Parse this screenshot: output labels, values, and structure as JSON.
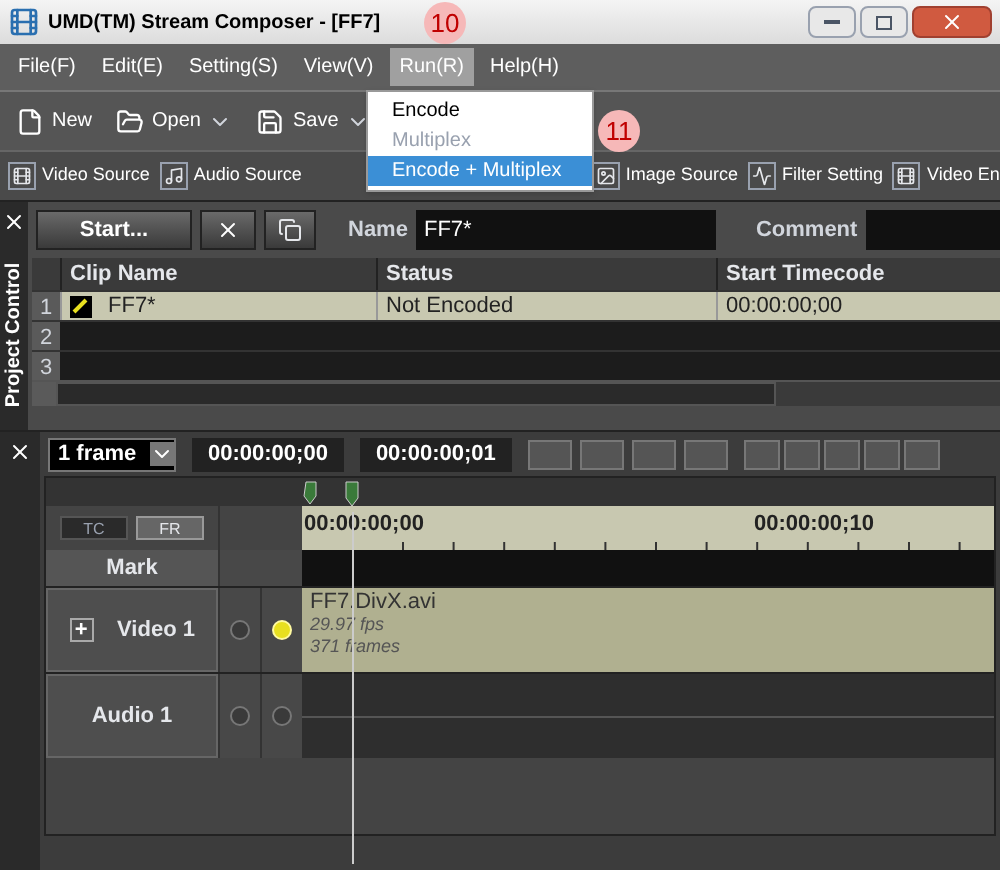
{
  "window": {
    "title": "UMD(TM) Stream Composer - [FF7]"
  },
  "menu": [
    {
      "label": "File(F)",
      "selected": false
    },
    {
      "label": "Edit(E)",
      "selected": false
    },
    {
      "label": "Setting(S)",
      "selected": false
    },
    {
      "label": "View(V)",
      "selected": false
    },
    {
      "label": "Run(R)",
      "selected": true
    },
    {
      "label": "Help(H)",
      "selected": false
    }
  ],
  "run_menu": [
    {
      "label": "Encode",
      "disabled": false,
      "selected": false
    },
    {
      "label": "Multiplex",
      "disabled": true,
      "selected": false
    },
    {
      "label": "Encode + Multiplex",
      "disabled": false,
      "selected": true
    }
  ],
  "annotations": [
    {
      "label": "10"
    },
    {
      "label": "11"
    }
  ],
  "toolbar": [
    {
      "label": "New",
      "kind": "button"
    },
    {
      "label": "Open",
      "kind": "dropdown"
    },
    {
      "label": "Save",
      "kind": "dropdown"
    }
  ],
  "source_toolbar": [
    {
      "label": "Video Source",
      "kind": "video"
    },
    {
      "label": "Audio Source",
      "kind": "audio"
    },
    {
      "label": "Image Source",
      "kind": "image"
    },
    {
      "label": "Filter Setting",
      "kind": "filter"
    },
    {
      "label": "Video En",
      "kind": "video"
    }
  ],
  "project_panel": {
    "title": "Project Control",
    "start_button": "Start...",
    "name_label": "Name",
    "name_value": "FF7*",
    "comment_label": "Comment"
  },
  "clips": {
    "columns": [
      "Clip Name",
      "Status",
      "Start Timecode"
    ],
    "rows": [
      {
        "number": "1",
        "selected": true,
        "checked": true,
        "cells": [
          "FF7*",
          "Not Encoded",
          "00:00:00;00"
        ]
      },
      {
        "number": "2",
        "selected": false
      },
      {
        "number": "3",
        "selected": false
      }
    ]
  },
  "timeline": {
    "step": "1 frame",
    "timecode_in": "00:00:00;00",
    "timecode_out": "00:00:00;01",
    "ruler_modes": [
      {
        "label": "TC",
        "selected": false
      },
      {
        "label": "FR",
        "selected": true
      }
    ],
    "ruler_labels": [
      "00:00:00;00",
      "00:00:00;10"
    ],
    "mark_label": "Mark",
    "tracks": [
      {
        "name": "Video 1",
        "kind": "video",
        "expand": "+",
        "active": true,
        "clip": {
          "name": "FF7.DivX.avi",
          "fps": "29.97 fps",
          "frames": "371 frames"
        }
      },
      {
        "name": "Audio 1",
        "kind": "audio",
        "active": false
      }
    ]
  }
}
